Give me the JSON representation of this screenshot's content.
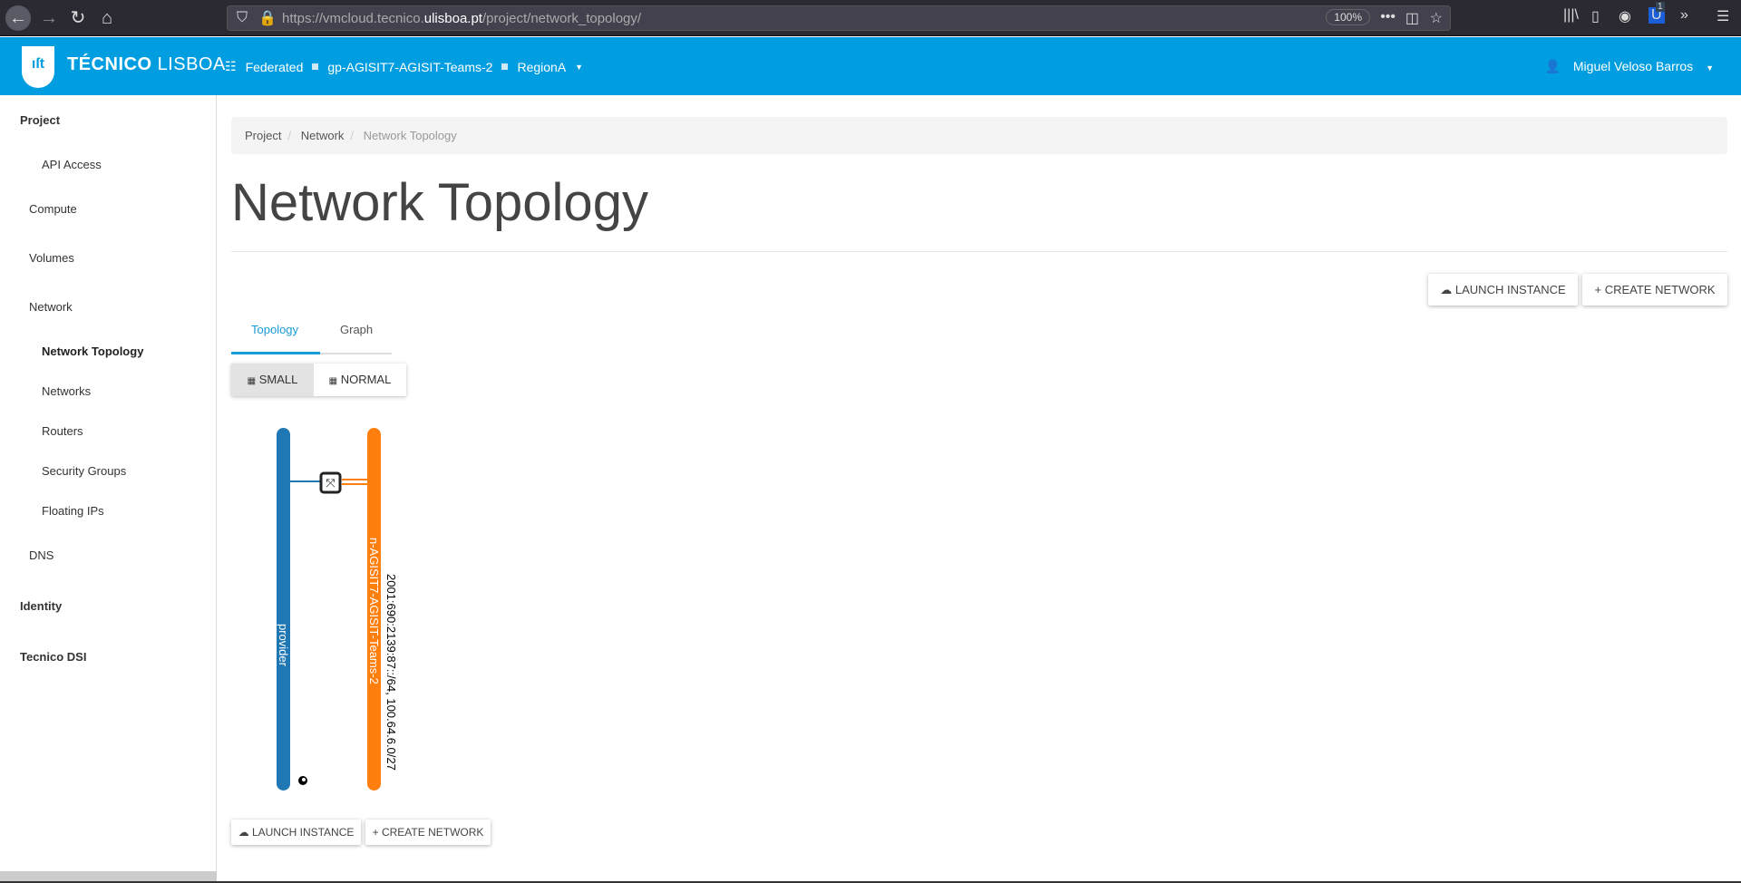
{
  "browser": {
    "url_prefix": "https://vmcloud.tecnico.",
    "url_domain": "ulisboa.pt",
    "url_path": "/project/network_topology/",
    "zoom": "100%",
    "badge": "1"
  },
  "header": {
    "brand_bold": "TÉCNICO",
    "brand_light": "LISBOA",
    "logo": "ist",
    "context": [
      "Federated",
      "gp-AGISIT7-AGISIT-Teams-2",
      "RegionA"
    ],
    "user": "Miguel Veloso Barros",
    "color": "#009ee0"
  },
  "sidebar": {
    "items": [
      {
        "label": "Project",
        "level": "header"
      },
      {
        "label": "API Access",
        "level": "2"
      },
      {
        "label": "Compute",
        "level": "1"
      },
      {
        "label": "Volumes",
        "level": "1"
      },
      {
        "label": "Network",
        "level": "1"
      },
      {
        "label": "Network Topology",
        "level": "2",
        "active": true
      },
      {
        "label": "Networks",
        "level": "2"
      },
      {
        "label": "Routers",
        "level": "2"
      },
      {
        "label": "Security Groups",
        "level": "2"
      },
      {
        "label": "Floating IPs",
        "level": "2"
      },
      {
        "label": "DNS",
        "level": "1"
      },
      {
        "label": "Identity",
        "level": "header"
      },
      {
        "label": "Tecnico DSI",
        "level": "header"
      }
    ]
  },
  "breadcrumb": [
    "Project",
    "Network",
    "Network Topology"
  ],
  "page_title": "Network Topology",
  "actions": {
    "launch": "Launch Instance",
    "create": "Create Network"
  },
  "tabs": [
    "Topology",
    "Graph"
  ],
  "size_buttons": [
    "Small",
    "Normal"
  ],
  "topology": {
    "networks": [
      {
        "name": "provider",
        "color": "#1f77b4",
        "external": true
      },
      {
        "name": "n-AGISIT7-AGISIT-Teams-2",
        "color": "#ff7f0e",
        "subnets": "2001:690:2139:87::/64, 100.64.6.0/27"
      }
    ],
    "router_icon": "router-icon"
  }
}
